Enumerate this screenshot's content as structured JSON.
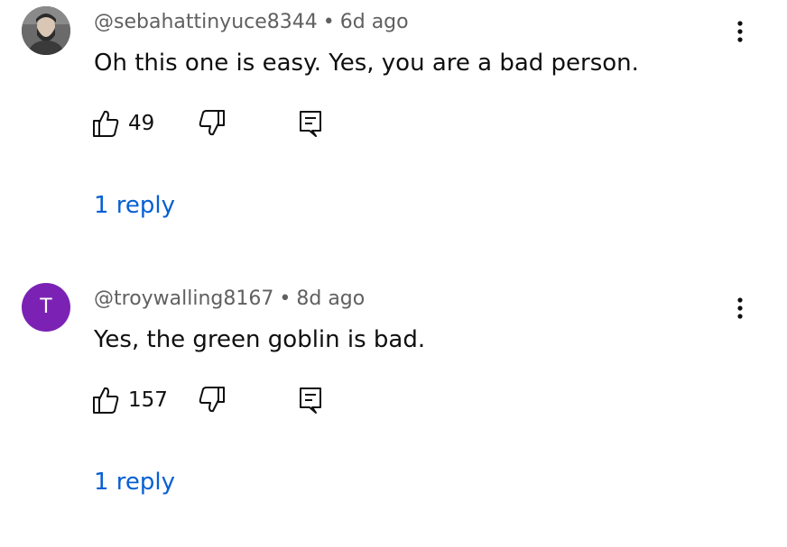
{
  "comments": [
    {
      "handle": "@sebahattinyuce8344",
      "time": "6d ago",
      "text": "Oh this one is easy. Yes, you are a bad person.",
      "likes": "49",
      "replies": "1 reply",
      "avatar": "profile-photo"
    },
    {
      "handle": "@troywalling8167",
      "time": "8d ago",
      "text": "Yes, the green goblin is bad.",
      "likes": "157",
      "replies": "1 reply",
      "avatar_letter": "T"
    }
  ],
  "meta_separator": "•",
  "colors": {
    "meta_text": "#606060",
    "body_text": "#0f0f0f",
    "link": "#065fd4",
    "letter_avatar_bg": "#7b22b4"
  },
  "icons": [
    "more-vert-icon",
    "thumb-up-icon",
    "thumb-down-icon",
    "reply-icon"
  ]
}
